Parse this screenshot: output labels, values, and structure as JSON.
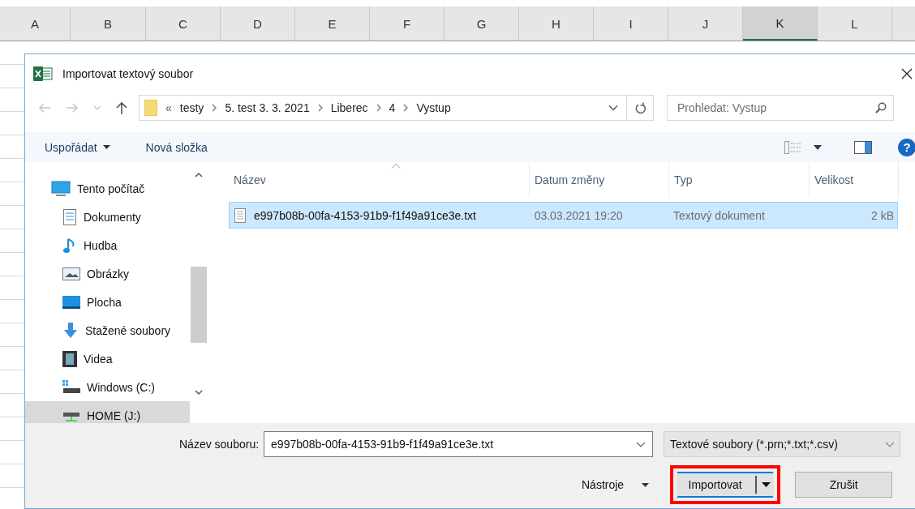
{
  "spreadsheet": {
    "columns": [
      {
        "label": "A",
        "selected": false
      },
      {
        "label": "B",
        "selected": false
      },
      {
        "label": "C",
        "selected": false
      },
      {
        "label": "D",
        "selected": false
      },
      {
        "label": "E",
        "selected": false
      },
      {
        "label": "F",
        "selected": false
      },
      {
        "label": "G",
        "selected": false
      },
      {
        "label": "H",
        "selected": false
      },
      {
        "label": "I",
        "selected": false
      },
      {
        "label": "J",
        "selected": false
      },
      {
        "label": "K",
        "selected": true
      },
      {
        "label": "L",
        "selected": false
      }
    ]
  },
  "dialog": {
    "title": "Importovat textový soubor",
    "breadcrumb": {
      "overflow_mark": "«",
      "items": [
        "testy",
        "5. test 3. 3. 2021",
        "Liberec",
        "4",
        "Vystup"
      ]
    },
    "search": {
      "placeholder": "Prohledat: Vystup"
    },
    "toolbar": {
      "organize": "Uspořádat",
      "new_folder": "Nová složka",
      "help_mark": "?"
    },
    "nav_items": [
      {
        "label": "Tento počítač",
        "kind": "computer",
        "selected": false,
        "children": [
          {
            "label": "Dokumenty",
            "kind": "documents",
            "selected": false
          },
          {
            "label": "Hudba",
            "kind": "music",
            "selected": false
          },
          {
            "label": "Obrázky",
            "kind": "pictures",
            "selected": false
          },
          {
            "label": "Plocha",
            "kind": "desktop",
            "selected": false
          },
          {
            "label": "Stažené soubory",
            "kind": "downloads",
            "selected": false
          },
          {
            "label": "Videa",
            "kind": "videos",
            "selected": false
          },
          {
            "label": "Windows (C:)",
            "kind": "drive",
            "selected": false
          },
          {
            "label": "HOME (J:)",
            "kind": "network",
            "selected": true
          }
        ]
      }
    ],
    "file_list": {
      "columns": [
        "Název",
        "Datum změny",
        "Typ",
        "Velikost"
      ],
      "rows": [
        {
          "name": "e997b08b-00fa-4153-91b9-f1f49a91ce3e.txt",
          "date": "03.03.2021 19:20",
          "type": "Textový dokument",
          "size": "2 kB",
          "selected": true
        }
      ]
    },
    "filename": {
      "label": "Název souboru:",
      "value": "e997b08b-00fa-4153-91b9-f1f49a91ce3e.txt"
    },
    "filter": {
      "value": "Textové soubory (*.prn;*.txt;*.csv)"
    },
    "tools": "Nástroje",
    "buttons": [
      {
        "label": "Importovat",
        "kind": "split",
        "highlighted": true
      },
      {
        "label": "Zrušit",
        "kind": "plain",
        "highlighted": false
      }
    ]
  }
}
